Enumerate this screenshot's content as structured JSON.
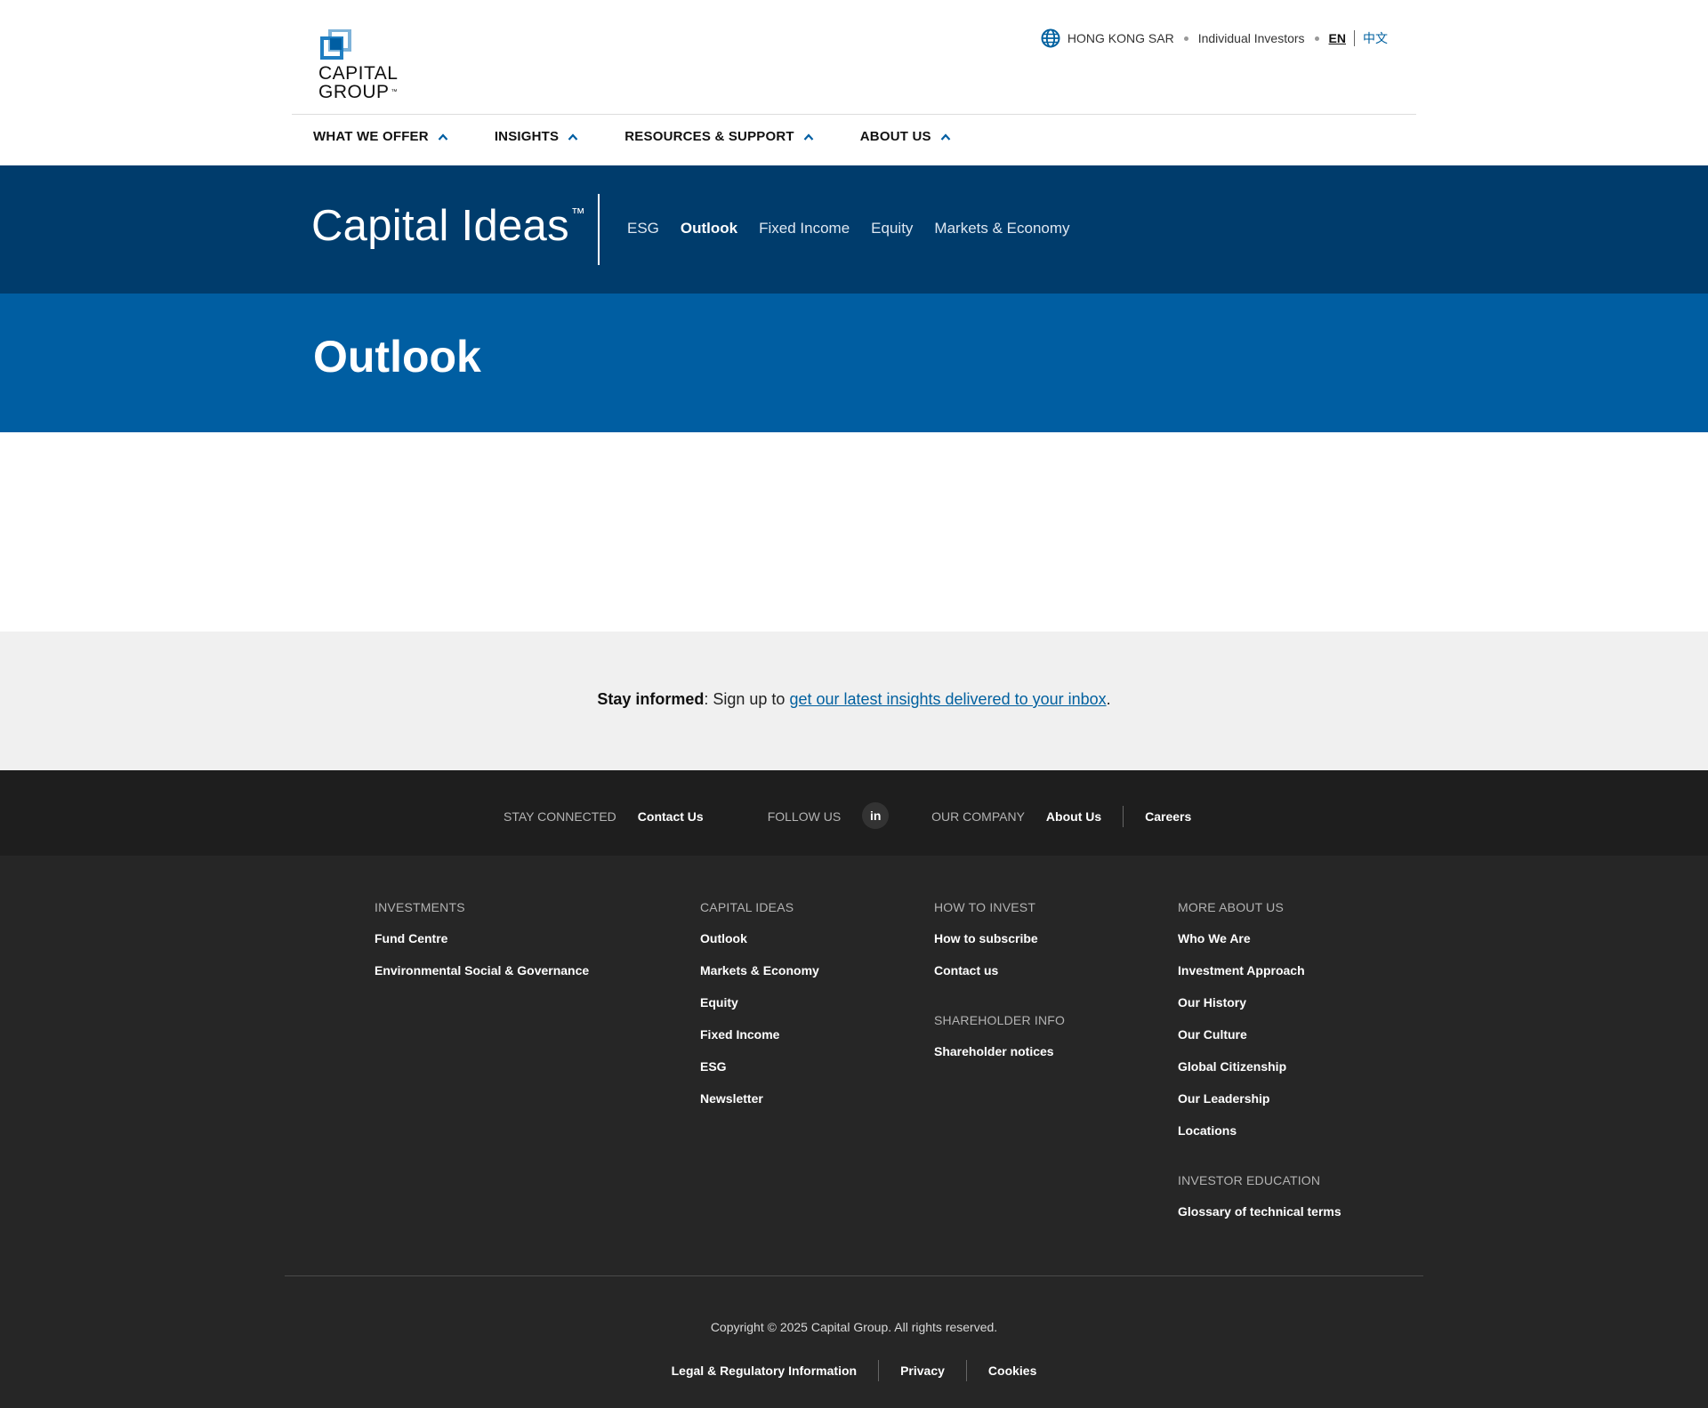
{
  "brand": {
    "logo_line1": "CAPITAL",
    "logo_line2": "GROUP",
    "logo_tm": "™",
    "primary_color": "#003c6c",
    "accent_color": "#005ea2",
    "link_color": "#00609f"
  },
  "utility": {
    "region": "HONG KONG SAR",
    "audience": "Individual Investors",
    "lang_en": "EN",
    "lang_zh": "中文"
  },
  "main_nav": [
    {
      "label": "WHAT WE OFFER",
      "icon": "chevron-up-icon"
    },
    {
      "label": "INSIGHTS",
      "icon": "chevron-up-icon"
    },
    {
      "label": "RESOURCES & SUPPORT",
      "icon": "chevron-up-icon"
    },
    {
      "label": "ABOUT US",
      "icon": "chevron-up-icon"
    }
  ],
  "capital_ideas": {
    "title": "Capital Ideas",
    "tm": "™",
    "nav": [
      {
        "label": "ESG"
      },
      {
        "label": "Outlook",
        "active": true
      },
      {
        "label": "Fixed Income"
      },
      {
        "label": "Equity"
      },
      {
        "label": "Markets & Economy"
      }
    ]
  },
  "hero": {
    "title": "Outlook"
  },
  "subscribe": {
    "bold": "Stay informed",
    "text": ": Sign up to ",
    "link": "get our latest insights delivered to your inbox",
    "end": "."
  },
  "connect": {
    "stay_connected_label": "STAY CONNECTED",
    "contact_us": "Contact Us",
    "follow_us_label": "FOLLOW US",
    "linkedin": "in",
    "our_company_label": "OUR COMPANY",
    "about_us": "About Us",
    "careers": "Careers"
  },
  "footer": {
    "investments": {
      "heading": "INVESTMENTS",
      "links": [
        "Fund Centre",
        "Environmental Social & Governance"
      ]
    },
    "capital_ideas": {
      "heading": "CAPITAL IDEAS",
      "links": [
        "Outlook",
        "Markets & Economy",
        "Equity",
        "Fixed Income",
        "ESG",
        "Newsletter"
      ]
    },
    "how_to_invest": {
      "heading": "HOW TO INVEST",
      "links": [
        "How to subscribe",
        "Contact us"
      ]
    },
    "shareholder_info": {
      "heading": "SHAREHOLDER INFO",
      "links": [
        "Shareholder notices"
      ]
    },
    "more_about_us": {
      "heading": "MORE ABOUT US",
      "links": [
        "Who We Are",
        "Investment Approach",
        "Our History",
        "Our Culture",
        "Global Citizenship",
        "Our Leadership",
        "Locations"
      ]
    },
    "investor_education": {
      "heading": "INVESTOR EDUCATION",
      "links": [
        "Glossary of technical terms"
      ]
    },
    "copyright": "Copyright © 2025 Capital Group. All rights reserved.",
    "legal": [
      "Legal & Regulatory Information",
      "Privacy",
      "Cookies"
    ]
  }
}
